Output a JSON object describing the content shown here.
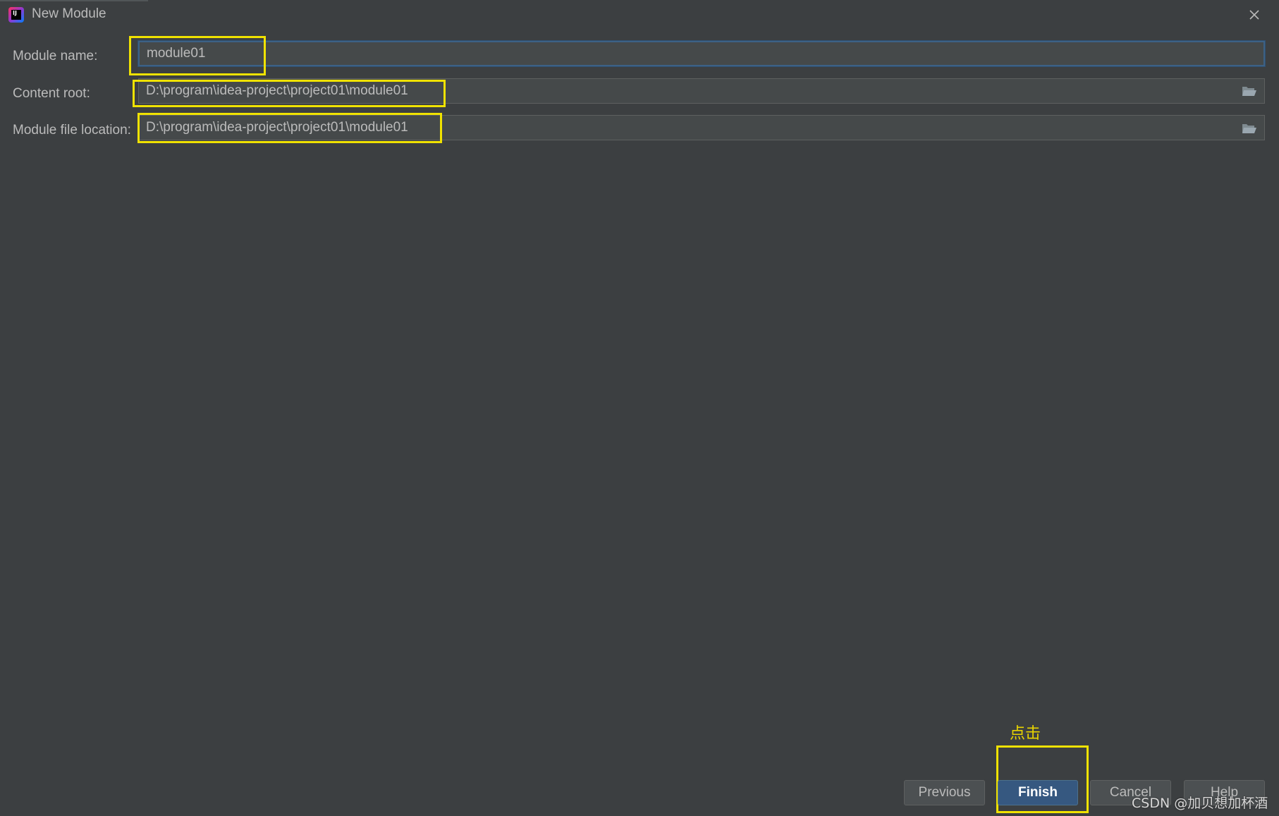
{
  "window": {
    "title": "New Module",
    "app_icon_text": "IJ",
    "icon_app": "intellij-idea-icon",
    "icon_close": "close-icon"
  },
  "form": {
    "module_name": {
      "label": "Module name:",
      "value": "module01"
    },
    "content_root": {
      "label": "Content root:",
      "value": "D:\\program\\idea-project\\project01\\module01",
      "icon": "folder-open-icon"
    },
    "module_file_location": {
      "label": "Module file location:",
      "value": "D:\\program\\idea-project\\project01\\module01",
      "icon": "folder-open-icon"
    }
  },
  "annotation": {
    "click_hint": "点击",
    "color": "#f0e200"
  },
  "buttons": {
    "previous": "Previous",
    "finish": "Finish",
    "cancel": "Cancel",
    "help": "Help"
  },
  "watermark": "CSDN @加贝想加杯酒",
  "colors": {
    "background": "#3c3f41",
    "field_background": "#45494a",
    "focus_border": "#3d6185",
    "primary_button": "#365880"
  }
}
